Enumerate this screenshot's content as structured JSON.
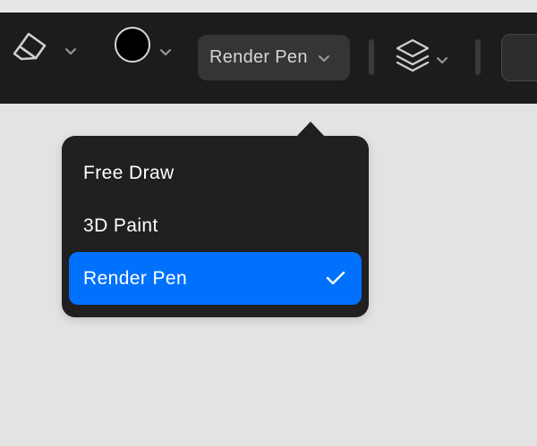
{
  "toolbar": {
    "eraser_button": {
      "icon": "eraser-icon"
    },
    "color_button": {
      "icon": "color-swatch",
      "color": "#000000"
    },
    "mode_select": {
      "value": "Render Pen"
    },
    "layers_button": {
      "icon": "layers-icon"
    }
  },
  "mode_menu": {
    "items": [
      {
        "label": "Free Draw",
        "selected": false
      },
      {
        "label": "3D Paint",
        "selected": false
      },
      {
        "label": "Render Pen",
        "selected": true
      }
    ],
    "selected_color": "#0071fd"
  },
  "colors": {
    "toolbar_bg": "#1e1b1b",
    "canvas_bg": "#e3e3e3",
    "menu_bg": "#211f20",
    "accent": "#0071fd"
  }
}
